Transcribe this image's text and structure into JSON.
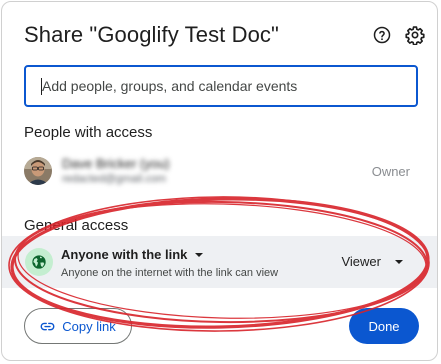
{
  "dialog": {
    "title": "Share \"Googlify Test Doc\"",
    "help_icon": "help-circle-icon",
    "settings_icon": "gear-icon"
  },
  "search": {
    "placeholder": "Add people, groups, and calendar events",
    "value": ""
  },
  "people_with_access": {
    "heading": "People with access",
    "people": [
      {
        "name": "Dave Bricker (you)",
        "email": "redacted@gmail.com",
        "role": "Owner",
        "avatar": "avatar-photo"
      }
    ]
  },
  "general_access": {
    "heading": "General access",
    "icon": "globe-icon",
    "selected_option": "Anyone with the link",
    "description": "Anyone on the internet with the link can view",
    "role_selected": "Viewer"
  },
  "footer": {
    "copy_link_label": "Copy link",
    "copy_link_icon": "link-icon",
    "done_label": "Done"
  },
  "colors": {
    "accent": "#0b57d0",
    "globe_bg": "#c4eed0",
    "access_row_bg": "#eef0f3",
    "annotation": "#d8232a"
  }
}
